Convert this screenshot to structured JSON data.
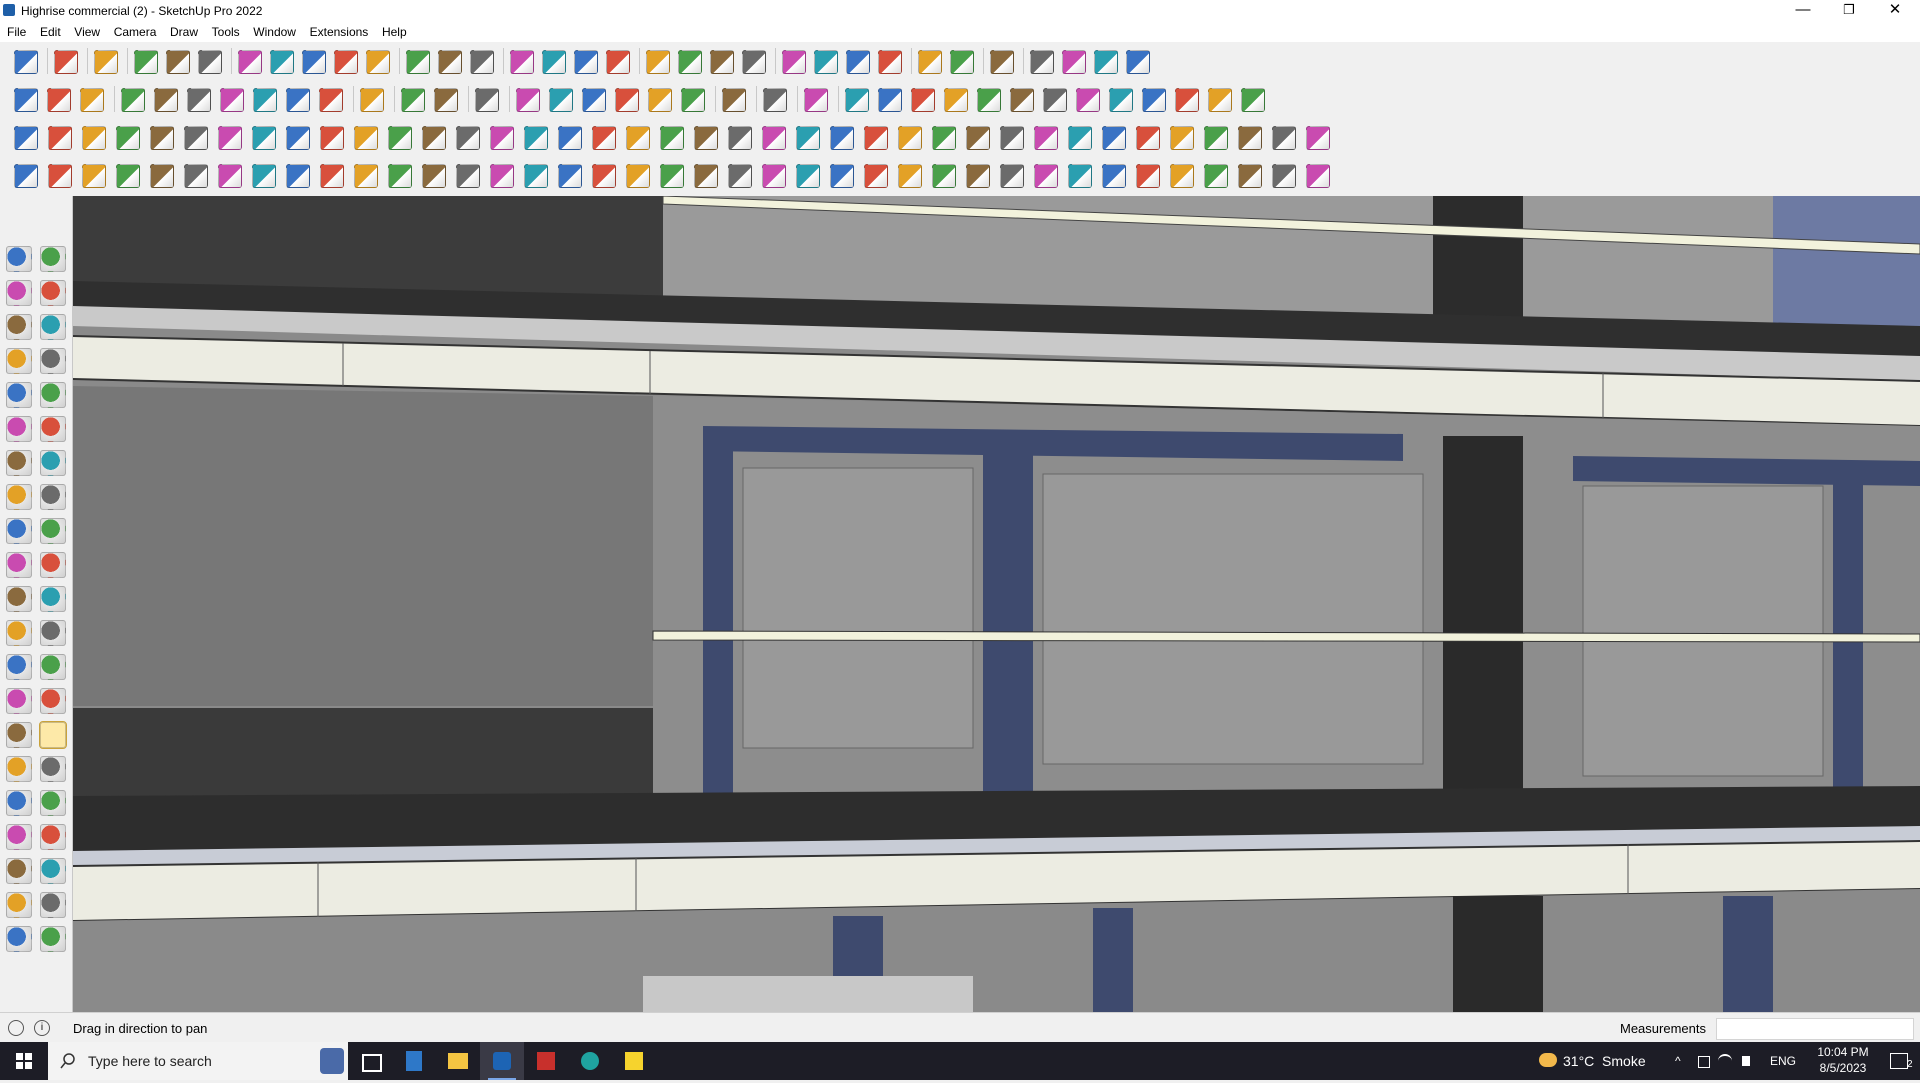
{
  "window": {
    "title": "Highrise commercial (2) - SketchUp Pro 2022",
    "controls": [
      "—",
      "❐",
      "✕"
    ]
  },
  "menu": [
    "File",
    "Edit",
    "View",
    "Camera",
    "Draw",
    "Tools",
    "Window",
    "Extensions",
    "Help"
  ],
  "toolbars": {
    "row1": [
      "search-icon",
      "select-icon",
      "eraser-icon",
      "pencil-icon",
      "freehand-icon",
      "rectangle-icon",
      "pushpull-icon",
      "follow-me-icon",
      "move-icon",
      "rotate-icon",
      "scale-icon",
      "tape-icon",
      "text-icon",
      "paint-icon",
      "orbit-icon",
      "pan-icon",
      "zoom-icon",
      "zoom-extents-icon",
      "section-plane-icon",
      "section-display-icon",
      "section-cut-icon",
      "style-icon",
      "scenes-icon",
      "component-icon",
      "paint-bucket-icon",
      "axis-icon",
      "up-arrow-icon",
      "down-arrow-icon",
      "position-camera-icon",
      "walk-icon",
      "undo-icon",
      "redo-icon",
      "hand-icon"
    ],
    "row2": [
      "box-icon",
      "box-shaded-icon",
      "box-texture-icon",
      "sandbox-icon",
      "stamp-icon",
      "drape-icon",
      "add-detail-icon",
      "flip-edge-icon",
      "smoove-icon",
      "contour-icon",
      "wall-icon",
      "wall-align-icon",
      "wall-top-icon",
      "terrain-icon",
      "terrain-green-icon",
      "house-icon",
      "house-roof-icon",
      "home-icon",
      "building-icon",
      "home-outline-icon",
      "shed-icon",
      "fx-icon",
      "hand-point-icon",
      "ruler-icon",
      "shape-rect-icon",
      "shape-circle-icon",
      "shape-hex-icon",
      "shape-ellipse-icon",
      "shape-para-icon",
      "shape-arc-icon",
      "shape-polygon-icon",
      "shape-star-icon",
      "shape-loft-icon",
      "shape-spiral-icon",
      "sweep-icon",
      "fillet-icon"
    ],
    "row3": [
      "plane-icon",
      "plane-blue-icon",
      "plane-yellow-icon",
      "plane-green-icon",
      "plane-red-icon",
      "plane-grey-icon",
      "rotate-orange-icon",
      "frame-red-icon",
      "table-icon",
      "door-icon",
      "chair-icon",
      "tile-icon",
      "pipe-icon",
      "bezier-icon",
      "cross-red-icon",
      "cross-green-icon",
      "scale-blue-icon",
      "cone-icon",
      "tent-icon",
      "warn-icon",
      "lasso-icon",
      "knot-icon",
      "spiral-icon",
      "target-icon",
      "box-wood-icon",
      "curve-red-icon",
      "tree-icon",
      "parts-icon",
      "mirror-icon",
      "cube-small-icon",
      "tag-icon",
      "boxes-icon",
      "lattice-icon",
      "grid-orange-icon",
      "grid-yellow-icon",
      "mesh-icon",
      "dots-icon",
      "arc-dots-icon",
      "matrix-icon"
    ],
    "row4": [
      "path-icon",
      "curve-icon",
      "corner-icon",
      "split-icon",
      "gear-icon",
      "cloud-icon",
      "bend-icon",
      "twist-icon",
      "gem-icon",
      "hook-icon",
      "stair-icon",
      "rail-icon",
      "line-icon",
      "ribbon-icon",
      "table-frame-icon",
      "stretch-icon",
      "column-icon",
      "spiral-stair-icon",
      "glove-icon",
      "leaf-icon",
      "scissors-icon",
      "stack-icon",
      "slope-icon",
      "hanger-icon",
      "spring-icon",
      "zigzag-icon",
      "bucket-icon",
      "drum-icon",
      "frame-icon",
      "truss-icon",
      "crate-icon",
      "grate-icon",
      "panels-icon",
      "fence-icon",
      "spindle-icon",
      "fan-icon",
      "roof-icon",
      "twin-icon",
      "hip-icon"
    ]
  },
  "left_tools": [
    "select-icon",
    "orbit-icon",
    "paint-icon",
    "eraser-icon",
    "component-icon",
    "tag-icon",
    "line-icon",
    "freehand-icon",
    "rectangle-icon",
    "rotated-rect-icon",
    "circle-icon",
    "polygon-icon",
    "arc-icon",
    "pie-icon",
    "arc3-icon",
    "arc2-icon",
    "move-icon",
    "pushpull-icon",
    "rotate-icon",
    "follow-me-icon",
    "scale-icon",
    "offset-icon",
    "tape-icon",
    "dimension-icon",
    "protractor-icon",
    "text-icon",
    "axes-icon",
    "3d-text-icon",
    "orbit2-icon",
    "pan-icon",
    "zoom-icon",
    "zoom-window-icon",
    "zoom-extents-icon",
    "previous-icon",
    "position-camera-icon",
    "look-around-icon",
    "walk-icon",
    "section-icon",
    "section-plane-icon",
    "section-fill-icon",
    "section-display-icon",
    "section-cut-icon"
  ],
  "statusbar": {
    "hint": "Drag in direction to pan",
    "measurements_label": "Measurements",
    "measurements_value": ""
  },
  "taskbar": {
    "search_placeholder": "Type here to search",
    "weather": "31°C  Smoke",
    "lang": "ENG",
    "time": "10:04 PM",
    "date": "8/5/2023",
    "notif_count": "2"
  }
}
